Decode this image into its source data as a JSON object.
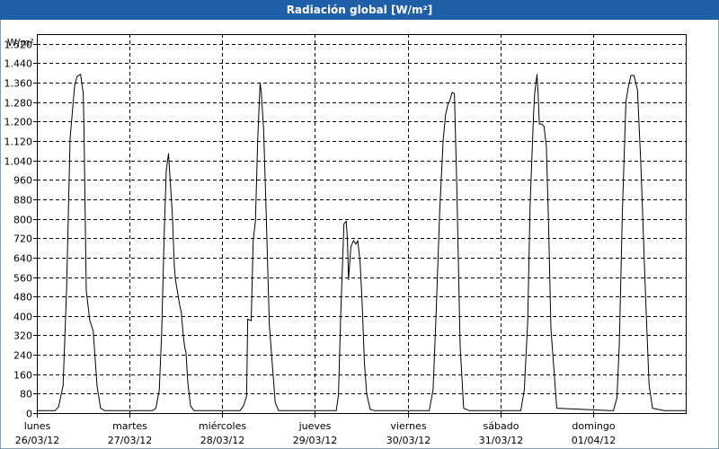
{
  "window": {
    "title": "Radiación global [W/m²]"
  },
  "chart_data": {
    "type": "line",
    "title": "Radiación global [W/m²]",
    "ylabel": "W/m²",
    "ylim": [
      0,
      1560
    ],
    "yticks": [
      0,
      80,
      160,
      240,
      320,
      400,
      480,
      560,
      640,
      720,
      800,
      880,
      960,
      1040,
      1120,
      1200,
      1280,
      1360,
      1440,
      1520
    ],
    "ytick_labels": [
      "0",
      "80",
      "160",
      "240",
      "320",
      "400",
      "480",
      "560",
      "640",
      "720",
      "800",
      "880",
      "960",
      "1.040",
      "1.120",
      "1.200",
      "1.280",
      "1.360",
      "1.440",
      "1.520"
    ],
    "xlim": [
      0,
      168
    ],
    "xticks": [
      {
        "x": 0,
        "day": "lunes",
        "date": "26/03/12"
      },
      {
        "x": 24,
        "day": "martes",
        "date": "27/03/12"
      },
      {
        "x": 48,
        "day": "miércoles",
        "date": "28/03/12"
      },
      {
        "x": 72,
        "day": "jueves",
        "date": "29/03/12"
      },
      {
        "x": 96,
        "day": "viernes",
        "date": "30/03/12"
      },
      {
        "x": 120,
        "day": "sábado",
        "date": "31/03/12"
      },
      {
        "x": 144,
        "day": "domingo",
        "date": "01/04/12"
      }
    ],
    "grid": true,
    "series": [
      {
        "name": "",
        "color": "#000000",
        "x": [
          0,
          4.7,
          5.6,
          6.8,
          7.7,
          8.6,
          9.8,
          10.4,
          11.3,
          12.0,
          12.2,
          12.8,
          13.7,
          14.6,
          15.6,
          16.5,
          17.6,
          18.8,
          19.6,
          28.7,
          29.9,
          30.8,
          31.7,
          32.3,
          33.0,
          33.5,
          34.1,
          34.5,
          35.1,
          35.6,
          35.9,
          36.5,
          37.0,
          37.4,
          37.9,
          38.3,
          38.6,
          39.1,
          39.8,
          40.7,
          52.6,
          53.5,
          54.3,
          54.6,
          55.5,
          56.0,
          56.6,
          57.2,
          57.8,
          58.1,
          58.7,
          59.3,
          60.2,
          61.7,
          62.6,
          63.5,
          76.6,
          77.5,
          78.1,
          78.7,
          79.5,
          80.1,
          80.4,
          80.7,
          81.3,
          82.0,
          82.6,
          83.1,
          83.7,
          84.2,
          84.8,
          85.4,
          86.3,
          87.5,
          100.7,
          101.6,
          102.6,
          103.4,
          104.3,
          105.2,
          105.8,
          106.4,
          106.9,
          107.5,
          108.1,
          108.7,
          109.6,
          110.5,
          112.0,
          124.4,
          125.3,
          126.2,
          127.1,
          127.7,
          128.6,
          128.9,
          129.5,
          129.8,
          130.1,
          130.7,
          131.3,
          131.9,
          132.5,
          133.1,
          134.6,
          148.4,
          149.3,
          150.2,
          150.8,
          151.6,
          152.5,
          153.1,
          153.8,
          154.6,
          155.5,
          156.4,
          157.6,
          158.5,
          159.4,
          162.4,
          168
        ],
        "y": [
          10,
          10,
          25,
          113,
          510,
          1131,
          1350,
          1385,
          1395,
          1317,
          1180,
          504,
          381,
          338,
          111,
          20,
          10,
          10,
          10,
          10,
          10,
          20,
          94,
          322,
          748,
          1000,
          1068,
          962,
          815,
          601,
          547,
          490,
          443,
          416,
          321,
          268,
          252,
          125,
          30,
          10,
          10,
          30,
          70,
          387,
          380,
          710,
          790,
          1131,
          1360,
          1320,
          1170,
          869,
          361,
          44,
          10,
          10,
          10,
          10,
          75,
          416,
          779,
          790,
          721,
          549,
          685,
          710,
          695,
          710,
          620,
          458,
          213,
          78,
          15,
          10,
          10,
          10,
          97,
          424,
          829,
          1123,
          1226,
          1270,
          1285,
          1320,
          1315,
          944,
          274,
          20,
          10,
          10,
          10,
          97,
          381,
          854,
          1233,
          1320,
          1394,
          1310,
          1190,
          1190,
          1180,
          1100,
          774,
          347,
          20,
          10,
          10,
          64,
          286,
          827,
          1280,
          1340,
          1390,
          1390,
          1330,
          1020,
          480,
          116,
          20,
          10,
          10
        ]
      }
    ]
  }
}
